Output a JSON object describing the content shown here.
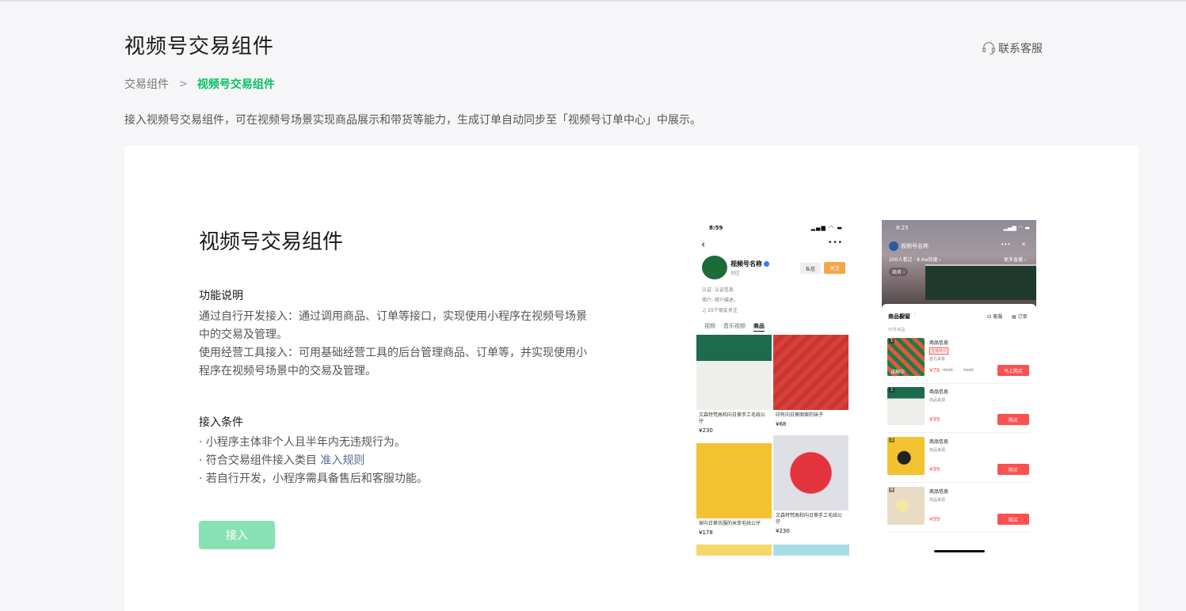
{
  "header": {
    "title": "视频号交易组件",
    "contact_label": "联系客服"
  },
  "breadcrumb": {
    "parent": "交易组件",
    "separator": ">",
    "current": "视频号交易组件"
  },
  "intro": "接入视频号交易组件，可在视频号场景实现商品展示和带货等能力，生成订单自动同步至「视频号订单中心」中展示。",
  "card": {
    "title": "视频号交易组件",
    "feature_title": "功能说明",
    "feature_lines": [
      "通过自行开发接入：通过调用商品、订单等接口，实现使用小程序在视频号场景",
      "中的交易及管理。",
      "使用经营工具接入：可用基础经营工具的后台管理商品、订单等，并实现使用小",
      "程序在视频号场景中的交易及管理。"
    ],
    "conditions_title": "接入条件",
    "conditions": [
      "· 小程序主体非个人且半年内无违规行为。",
      "· 符合交易组件接入类目",
      "· 若自行开发，小程序需具备售后和客服功能。"
    ],
    "conditions_link": "准入规则",
    "join_label": "接入"
  },
  "phone1": {
    "time": "8:59",
    "status_icons": "▂▄▆ ◠ ▬",
    "back": "‹",
    "more": "•••",
    "name": "视频号名称",
    "region": "地区",
    "msg_btn": "私信",
    "follow_btn": "关注",
    "meta": [
      "认证: 认证信息",
      "简介: 简介描述。",
      "♫ 25个朋友关注"
    ],
    "tabs": [
      "视频",
      "音乐视频",
      "商品"
    ],
    "products": [
      {
        "title": "文森特梵高和向日葵手工毛线公仔",
        "price": "¥230",
        "color": "#1d6b4f"
      },
      {
        "title": "印有向日葵图案的袜子",
        "price": "¥68",
        "color": "#d8403a"
      },
      {
        "title": "穿向日葵衣服的米菲毛线公仔",
        "price": "¥178",
        "color": "#f2c231"
      },
      {
        "title": "文森特梵高和向日葵手工毛线公仔",
        "price": "¥230",
        "color": "#dfe0e6"
      }
    ]
  },
  "phone2": {
    "time": "8:25",
    "status_icons": "▂▄▆ ◠ ▬",
    "channel_name": "视频号名称",
    "viewers": "200人看过 · 8.6w热度 ›",
    "more_live": "更多直播 ›",
    "close": "✕",
    "more": "•••",
    "tag": "商务 ›",
    "shelf_title": "商品橱窗",
    "shelf_info": "ⁱ",
    "service": "客服",
    "orders": "订单",
    "count": "50件商品",
    "items": [
      {
        "no": "1",
        "name": "商品信息",
        "badge": "直播特价",
        "sub": "首孔来系",
        "price": "¥76",
        "orig": "¥100",
        "btn": "马上购买",
        "live": "讲解中",
        "color": "#e05a3a"
      },
      {
        "no": "2",
        "name": "商品信息",
        "sub": "商品来源",
        "price": "¥99",
        "btn": "购买",
        "color": "#1d6b4f"
      },
      {
        "no": "3",
        "name": "商品信息",
        "sub": "商品来源",
        "price": "¥99",
        "btn": "购买",
        "color": "#f2c231"
      },
      {
        "no": "4",
        "name": "商品信息",
        "sub": "商品来源",
        "price": "¥99",
        "btn": "购买",
        "color": "#e9dcc4"
      }
    ]
  }
}
